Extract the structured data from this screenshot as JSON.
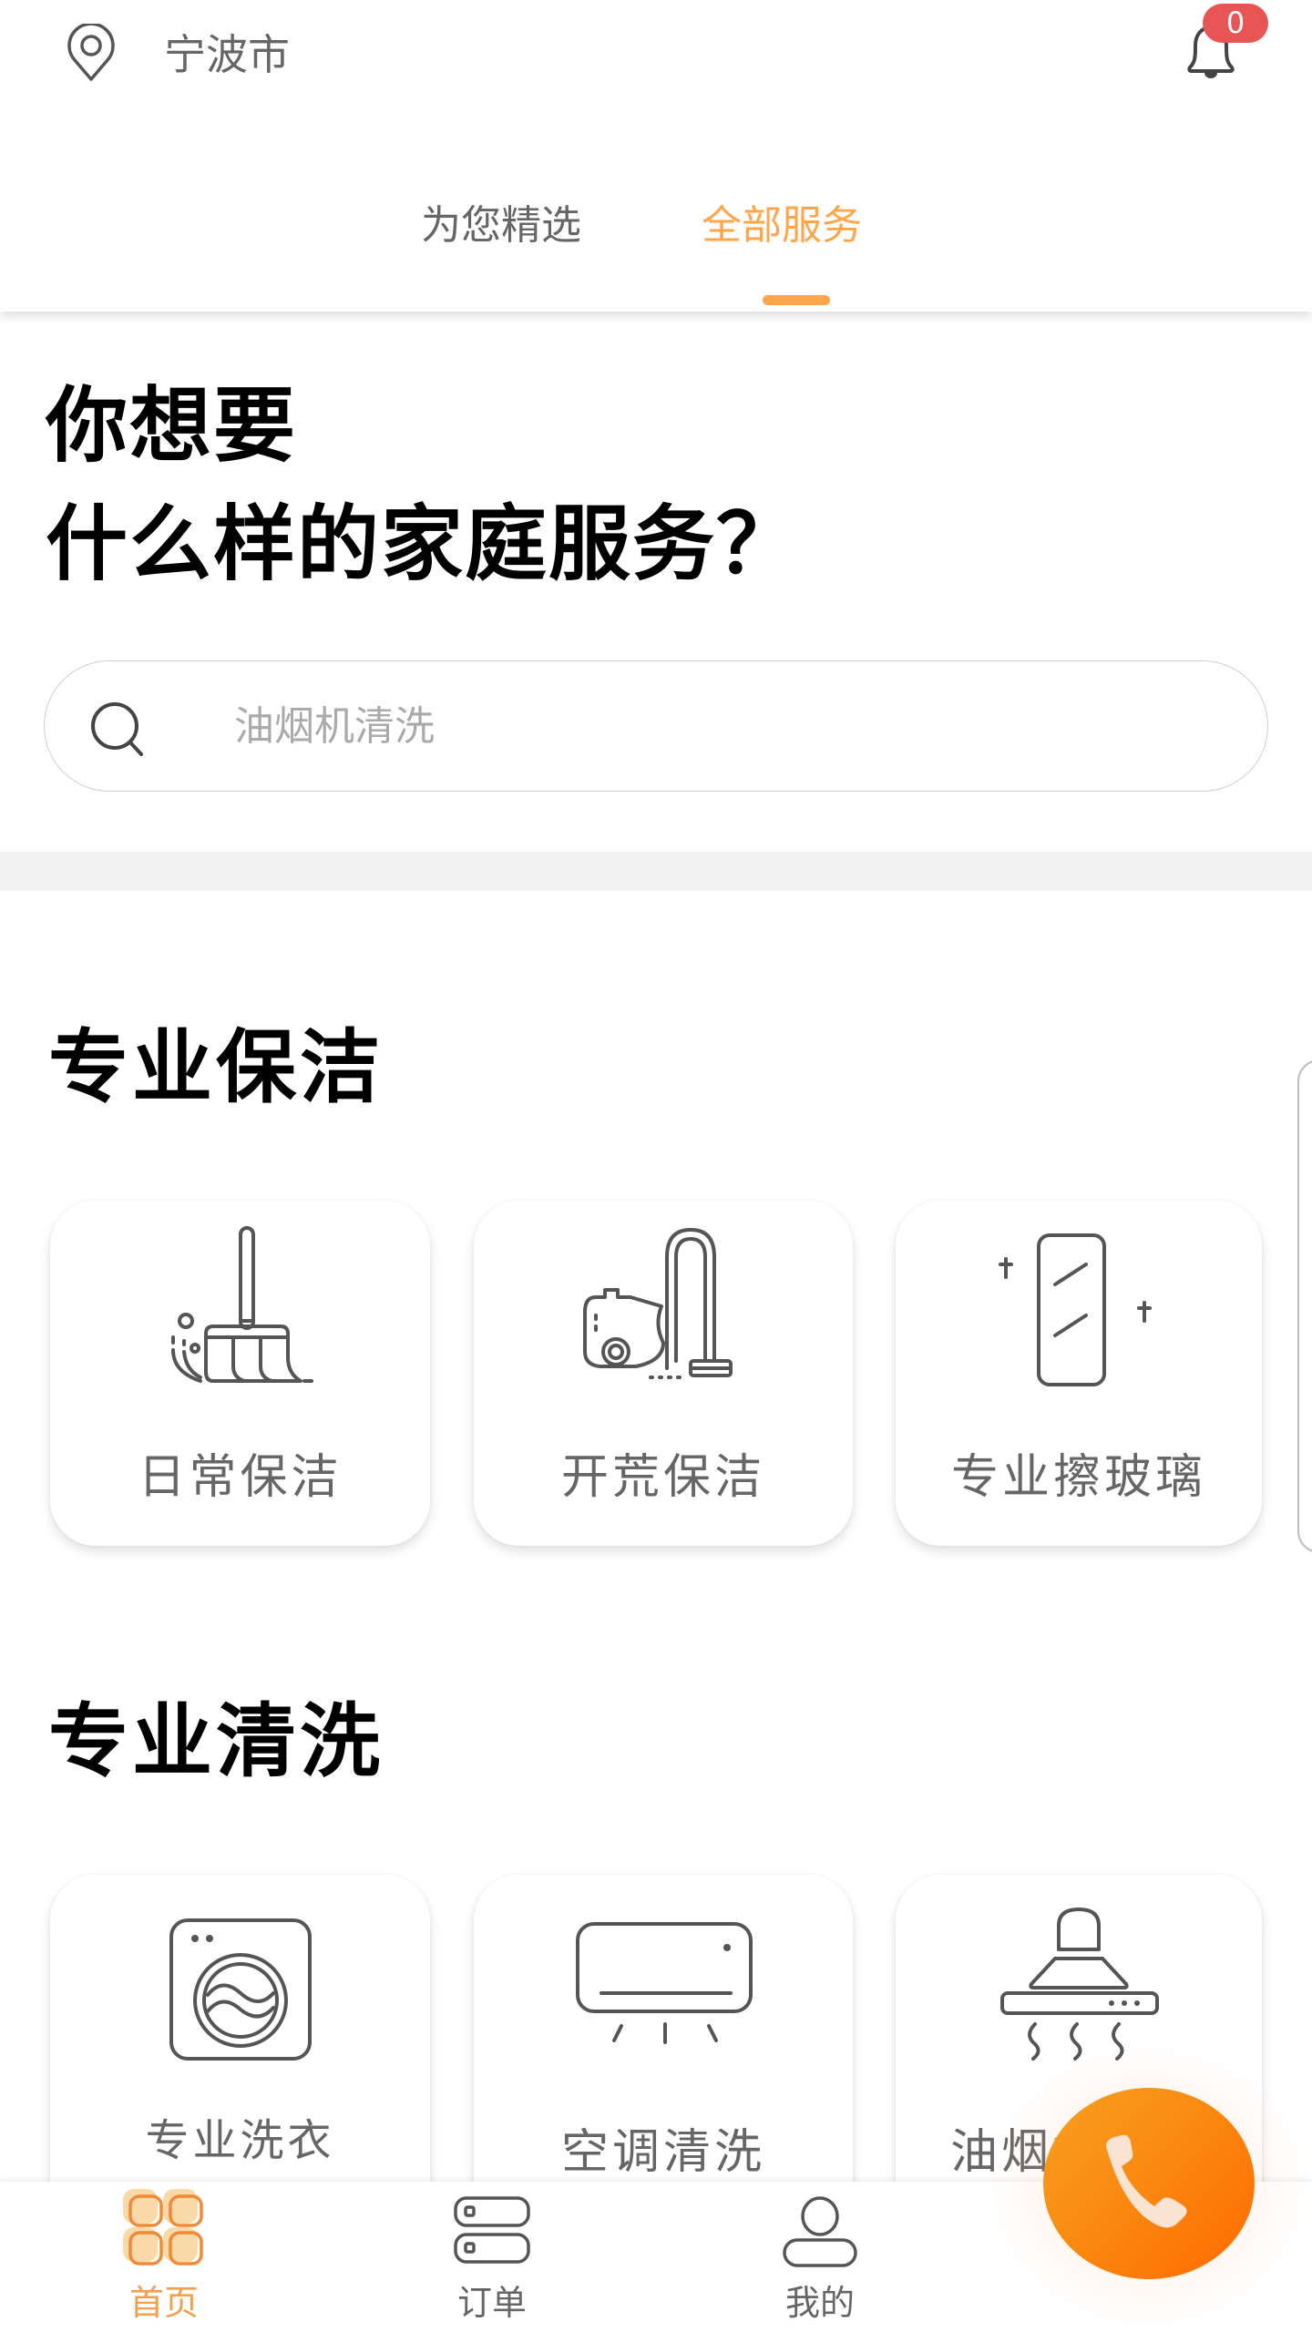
{
  "header": {
    "location_icon": "map-pin-icon",
    "city": "宁波市",
    "notification_icon": "bell-icon",
    "notification_count": "0",
    "tabs": [
      {
        "label": "为您精选",
        "active": false
      },
      {
        "label": "全部服务",
        "active": true
      }
    ]
  },
  "headline": {
    "line1": "你想要",
    "line2": "什么样的家庭服务？"
  },
  "search": {
    "icon": "search-icon",
    "placeholder": "油烟机清洗",
    "value": ""
  },
  "sections": [
    {
      "title": "专业保洁",
      "items": [
        {
          "label": "日常保洁",
          "icon": "broom-icon"
        },
        {
          "label": "开荒保洁",
          "icon": "vacuum-cleaner-icon"
        },
        {
          "label": "专业擦玻璃",
          "icon": "window-glass-icon"
        }
      ]
    },
    {
      "title": "专业清洗",
      "items": [
        {
          "label": "专业洗衣",
          "icon": "washing-machine-icon"
        },
        {
          "label": "空调清洗",
          "icon": "air-conditioner-icon"
        },
        {
          "label": "油烟机清洗",
          "icon": "range-hood-icon"
        }
      ]
    }
  ],
  "bottom_nav": {
    "items": [
      {
        "label": "首页",
        "icon": "home-grid-icon",
        "active": true
      },
      {
        "label": "订单",
        "icon": "orders-icon",
        "active": false
      },
      {
        "label": "我的",
        "icon": "profile-icon",
        "active": false
      }
    ]
  },
  "fab": {
    "icon": "phone-icon"
  },
  "colors": {
    "accent": "#FFA64D",
    "badge": "#E85555",
    "fab_start": "#F7A021",
    "fab_end": "#FF6A00",
    "text_gray": "#666666",
    "divider_band": "#F2F2F2"
  }
}
